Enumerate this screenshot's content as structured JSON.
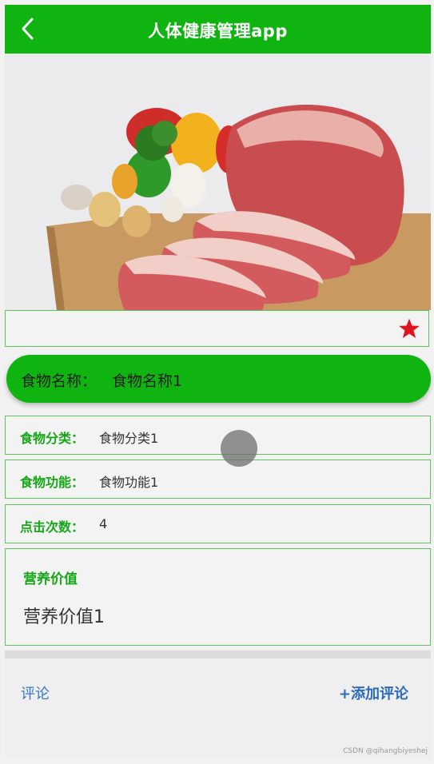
{
  "header": {
    "title": "人体健康管理app",
    "back_icon": "chevron-left-icon"
  },
  "hero": {
    "image": "raw-meat-and-vegetables-photo",
    "carousel_dots": 1
  },
  "favorite": {
    "icon": "star-icon",
    "color": "#e0141e"
  },
  "food": {
    "name_label": "食物名称：",
    "name_value": "食物名称1"
  },
  "details": [
    {
      "key": "食物分类：",
      "value": "食物分类1"
    },
    {
      "key": "食物功能：",
      "value": "食物功能1"
    },
    {
      "key": "点击次数：",
      "value": "4"
    }
  ],
  "nutrition": {
    "label": "营养价值",
    "value": "营养价值1"
  },
  "comments": {
    "title": "评论",
    "add_label": "+添加评论"
  },
  "watermark": "CSDN @qihangbiyeshej",
  "colors": {
    "primary": "#0fb410",
    "link": "#2c6bbd",
    "border": "#5cc35c"
  }
}
